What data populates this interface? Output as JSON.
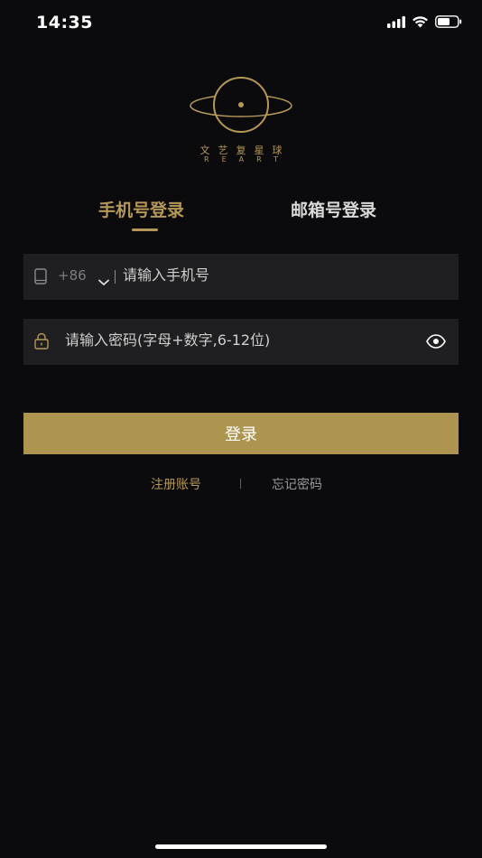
{
  "status_bar": {
    "time": "14:35",
    "icons": [
      "cellular-signal-icon",
      "wifi-icon",
      "battery-icon"
    ]
  },
  "logo": {
    "icon": "planet-ring-logo",
    "name_cn": "文艺复星球",
    "name_en": "REART"
  },
  "tabs": [
    {
      "label": "手机号登录",
      "active": true
    },
    {
      "label": "邮箱号登录",
      "active": false
    }
  ],
  "phone_field": {
    "icon": "phone-icon",
    "country_code": "+86",
    "placeholder": "请输入手机号",
    "value": ""
  },
  "password_field": {
    "icon": "lock-icon",
    "placeholder": "请输入密码(字母+数字,6-12位)",
    "value": "",
    "toggle_icon": "eye-icon"
  },
  "login_button": {
    "label": "登录"
  },
  "links": {
    "register": "注册账号",
    "forgot_password": "忘记密码"
  },
  "colors": {
    "background": "#0b0a0c",
    "accent_gold": "#b59858",
    "button_gold": "#ad9550",
    "field_background": "#1f1e20"
  }
}
